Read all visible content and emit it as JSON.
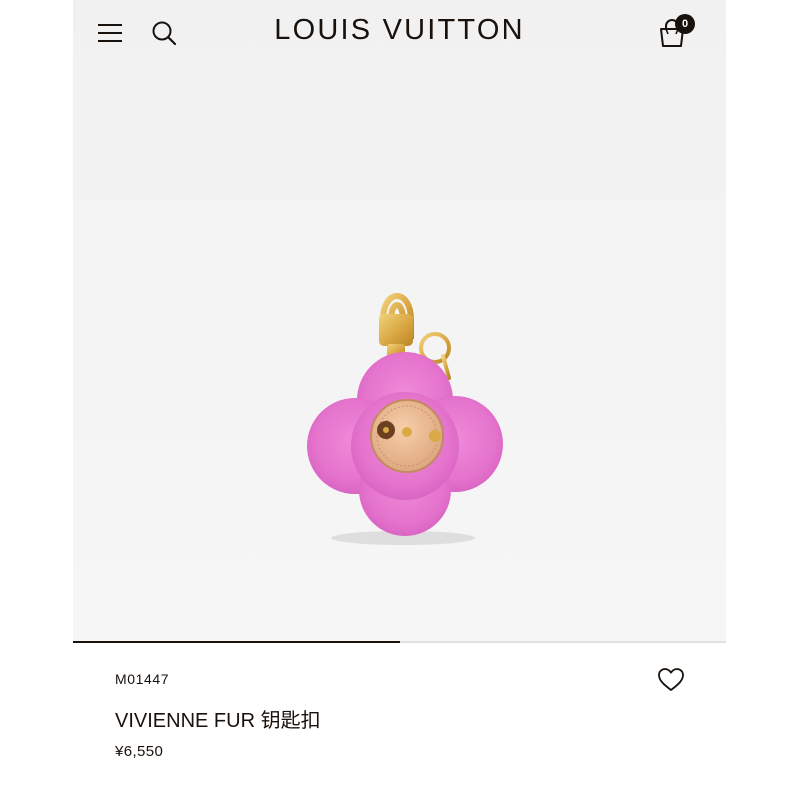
{
  "header": {
    "brand": "LOUIS VUITTON",
    "cart_count": "0",
    "icons": {
      "menu": "hamburger-menu-icon",
      "search": "search-icon",
      "cart": "shopping-bag-icon"
    }
  },
  "gallery": {
    "image_alt": "VIVIENNE FUR 钥匙扣",
    "progress": 0.5
  },
  "product": {
    "sku": "M01447",
    "name": "VIVIENNE FUR 钥匙扣",
    "price": "¥6,550",
    "wishlist_icon": "heart-outline-icon"
  },
  "colors": {
    "ink": "#19110b",
    "fur": "#e67ad0",
    "leather": "#e8b88f",
    "gold": "#d9aa45"
  }
}
